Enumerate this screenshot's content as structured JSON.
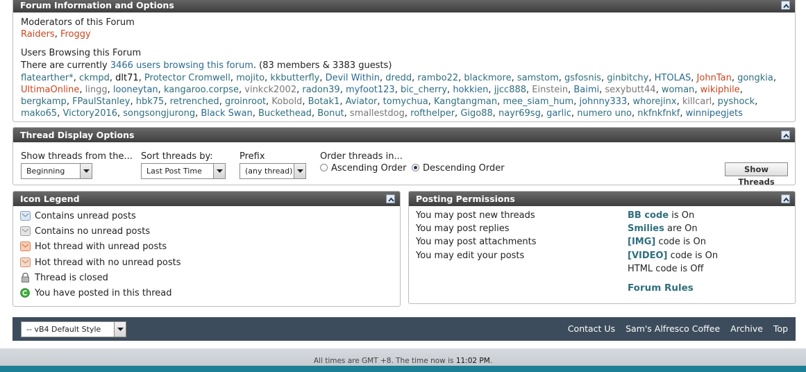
{
  "forum_info": {
    "header": "Forum Information and Options",
    "moderators_title": "Moderators of this Forum",
    "moderators": [
      "Raiders",
      "Froggy"
    ],
    "browsing_title": "Users Browsing this Forum",
    "browsing_prefix": "There are currently ",
    "browsing_link": "3466 users browsing this forum",
    "browsing_suffix": ". (83 members & 3383 guests)",
    "users": [
      {
        "name": "flatearther*",
        "color": "teal"
      },
      {
        "name": "ckmpd",
        "color": "teal"
      },
      {
        "name": "dlt71",
        "color": "black"
      },
      {
        "name": "Protector Cromwell",
        "color": "teal"
      },
      {
        "name": "mojito",
        "color": "teal"
      },
      {
        "name": "kkbutterfly",
        "color": "teal"
      },
      {
        "name": "Devil Within",
        "color": "blue"
      },
      {
        "name": "dredd",
        "color": "teal"
      },
      {
        "name": "rambo22",
        "color": "teal"
      },
      {
        "name": "blackmore",
        "color": "teal"
      },
      {
        "name": "samstom",
        "color": "teal"
      },
      {
        "name": "gsfosnis",
        "color": "teal"
      },
      {
        "name": "ginbitchy",
        "color": "teal"
      },
      {
        "name": "HTOLAS",
        "color": "blue"
      },
      {
        "name": "JohnTan",
        "color": "red"
      },
      {
        "name": "gongkia",
        "color": "teal"
      },
      {
        "name": "UltimaOnline",
        "color": "red"
      },
      {
        "name": "lingg",
        "color": "gray"
      },
      {
        "name": "looneytan",
        "color": "blue"
      },
      {
        "name": "kangaroo.corpse",
        "color": "teal"
      },
      {
        "name": "vinkck2002",
        "color": "gray"
      },
      {
        "name": "radon39",
        "color": "teal"
      },
      {
        "name": "myfoot123",
        "color": "blue"
      },
      {
        "name": "bic_cherry",
        "color": "teal"
      },
      {
        "name": "hokkien",
        "color": "blue"
      },
      {
        "name": "jjcc888",
        "color": "teal"
      },
      {
        "name": "Einstein",
        "color": "gray"
      },
      {
        "name": "Baimi",
        "color": "blue"
      },
      {
        "name": "sexybutt44",
        "color": "gray"
      },
      {
        "name": "woman",
        "color": "teal"
      },
      {
        "name": "wikiphile",
        "color": "red"
      },
      {
        "name": "bergkamp",
        "color": "teal"
      },
      {
        "name": "FPaulStanley",
        "color": "teal"
      },
      {
        "name": "hbk75",
        "color": "teal"
      },
      {
        "name": "retrenched",
        "color": "teal"
      },
      {
        "name": "groinroot",
        "color": "teal"
      },
      {
        "name": "Kobold",
        "color": "gray"
      },
      {
        "name": "Botak1",
        "color": "teal"
      },
      {
        "name": "Aviator",
        "color": "teal"
      },
      {
        "name": "tomychua",
        "color": "teal"
      },
      {
        "name": "Kangtangman",
        "color": "teal"
      },
      {
        "name": "mee_siam_hum",
        "color": "teal"
      },
      {
        "name": "johnny333",
        "color": "blue"
      },
      {
        "name": "whorejinx",
        "color": "teal"
      },
      {
        "name": "killcarl",
        "color": "gray"
      },
      {
        "name": "pyshock",
        "color": "teal"
      },
      {
        "name": "mako65",
        "color": "teal"
      },
      {
        "name": "Victory2016",
        "color": "teal"
      },
      {
        "name": "songsongjurong",
        "color": "teal"
      },
      {
        "name": "Black Swan",
        "color": "blue"
      },
      {
        "name": "Buckethead",
        "color": "teal"
      },
      {
        "name": "Bonut",
        "color": "teal"
      },
      {
        "name": "smallestdog",
        "color": "gray"
      },
      {
        "name": "rofthelper",
        "color": "teal"
      },
      {
        "name": "Gigo88",
        "color": "teal"
      },
      {
        "name": "nayr69sg",
        "color": "teal"
      },
      {
        "name": "garlic",
        "color": "blue"
      },
      {
        "name": "numero uno",
        "color": "teal"
      },
      {
        "name": "nkfnkfnkf",
        "color": "teal"
      },
      {
        "name": "winnipegjets",
        "color": "blue"
      }
    ]
  },
  "thread_display": {
    "header": "Thread Display Options",
    "show_from_label": "Show threads from the...",
    "show_from_value": "Beginning",
    "sort_label": "Sort threads by:",
    "sort_value": "Last Post Time",
    "prefix_label": "Prefix",
    "prefix_value": "(any thread)",
    "order_label": "Order threads in...",
    "ascending": "Ascending Order",
    "descending": "Descending Order",
    "selected_order": "descending",
    "button": "Show Threads"
  },
  "icon_legend": {
    "header": "Icon Legend",
    "items": [
      {
        "text": "Contains unread posts",
        "icon": "unread-posts-icon"
      },
      {
        "text": "Contains no unread posts",
        "icon": "no-unread-posts-icon"
      },
      {
        "text": "Hot thread with unread posts",
        "icon": "hot-unread-icon"
      },
      {
        "text": "Hot thread with no unread posts",
        "icon": "hot-no-unread-icon"
      },
      {
        "text": "Thread is closed",
        "icon": "lock-icon"
      },
      {
        "text": "You have posted in this thread",
        "icon": "posted-icon"
      }
    ]
  },
  "posting_permissions": {
    "header": "Posting Permissions",
    "left": [
      "You may post new threads",
      "You may post replies",
      "You may post attachments",
      "You may edit your posts"
    ],
    "bb_code": {
      "link": "BB code",
      "rest": " is On"
    },
    "smilies": {
      "link": "Smilies",
      "rest": " are On"
    },
    "img": {
      "link": "[IMG]",
      "rest": " code is On"
    },
    "video": {
      "link": "[VIDEO]",
      "rest": " code is On"
    },
    "html": "HTML code is Off",
    "rules": "Forum Rules"
  },
  "footer": {
    "style_value": "-- vB4 Default Style",
    "links": [
      "Contact Us",
      "Sam's Alfresco Coffee",
      "Archive",
      "Top"
    ],
    "time_prefix": "All times are GMT +8. The time now is ",
    "time_value": "11:02 PM",
    "time_suffix": "."
  },
  "colors": {
    "header_bg": "#4a4a4a",
    "link_teal": "#2e6e7e",
    "moderator_red": "#c8461e",
    "footer_bar": "#3d4c5c"
  }
}
